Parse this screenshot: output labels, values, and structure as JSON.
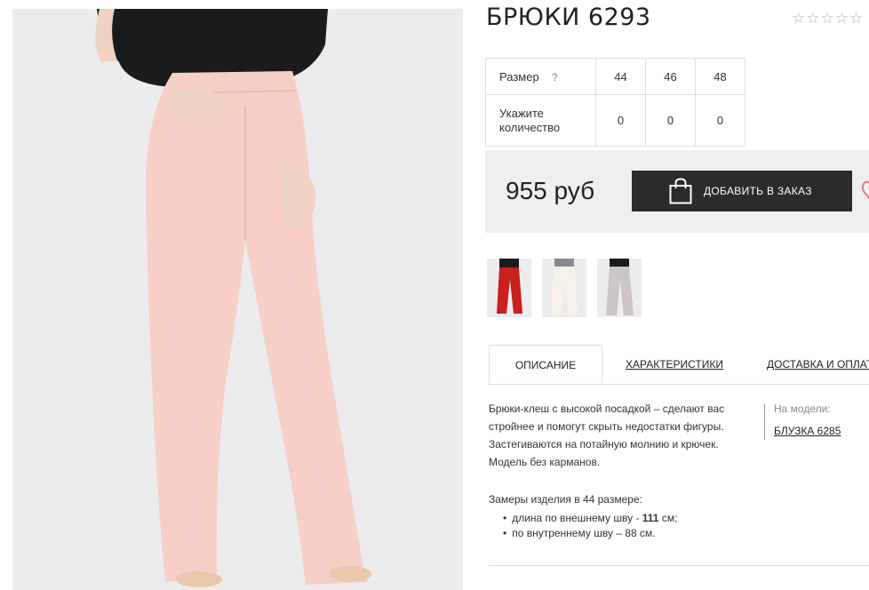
{
  "product": {
    "title": "БРЮКИ 6293",
    "rating_stars": "☆☆☆☆☆"
  },
  "size_table": {
    "size_label": "Размер",
    "help_mark": "?",
    "sizes": [
      "44",
      "46",
      "48"
    ],
    "qty_label": "Укажите количество",
    "quantities": [
      "0",
      "0",
      "0"
    ]
  },
  "purchase": {
    "price": "955 руб",
    "add_button": "ДОБАВИТЬ В ЗАКАЗ",
    "icons": [
      "shopping-bag-icon",
      "heart-icon"
    ]
  },
  "thumbnails": [
    {
      "name": "red",
      "color": "#c81f1f"
    },
    {
      "name": "white",
      "color": "#f3ede6"
    },
    {
      "name": "grey",
      "color": "#c9c2c6"
    }
  ],
  "tabs": {
    "active": "ОПИСАНИЕ",
    "second": "ХАРАКТЕРИСТИКИ",
    "third": "ДОСТАВКА И ОПЛАТА"
  },
  "description": {
    "text": "Брюки-клеш с высокой посадкой – сделают вас стройнее и помогут скрыть недостатки фигуры. Застегиваются на потайную молнию и крючек. Модель без карманов.",
    "on_model_label": "На модели:",
    "on_model_link": "БЛУЗКА 6285",
    "measure_heading": "Замеры изделия в 44 размере:",
    "measure_1_prefix": "длина по внешнему шву - ",
    "measure_1_value": "111",
    "measure_1_suffix": " см;",
    "measure_2": "по внутреннему шву – 88 см."
  },
  "colors": {
    "button_bg": "#2b2b2b",
    "pants_pink": "#f6cfc6",
    "heart_pink": "#e07b86"
  }
}
